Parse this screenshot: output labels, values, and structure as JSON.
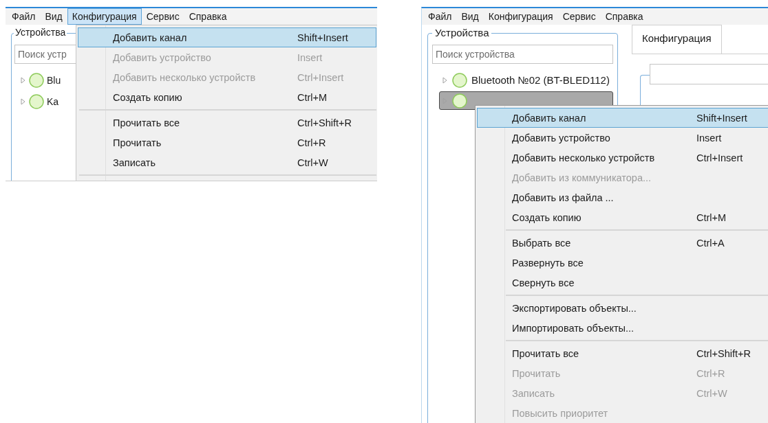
{
  "windows": [
    {
      "kind": "dropdown",
      "menu_bar": [
        {
          "label": "Файл",
          "selected": false
        },
        {
          "label": "Вид",
          "selected": false
        },
        {
          "label": "Конфигурация",
          "selected": true
        },
        {
          "label": "Сервис",
          "selected": false
        },
        {
          "label": "Справка",
          "selected": false
        }
      ],
      "devices": {
        "title": "Устройства",
        "search": {
          "placeholder": "Поиск устр"
        },
        "tree": [
          {
            "label": "Blu",
            "selected": false
          },
          {
            "label": "Ka",
            "selected": false
          }
        ]
      },
      "menu": {
        "items": [
          {
            "kind": "item",
            "label": "Добавить канал",
            "shortcut": "Shift+Insert",
            "selected": true,
            "disabled": false
          },
          {
            "kind": "item",
            "label": "Добавить устройство",
            "shortcut": "Insert",
            "selected": false,
            "disabled": true
          },
          {
            "kind": "item",
            "label": "Добавить несколько устройств",
            "shortcut": "Ctrl+Insert",
            "selected": false,
            "disabled": true
          },
          {
            "kind": "item",
            "label": "Создать копию",
            "shortcut": "Ctrl+M",
            "selected": false,
            "disabled": false
          },
          {
            "kind": "separator"
          },
          {
            "kind": "item",
            "label": "Прочитать все",
            "shortcut": "Ctrl+Shift+R",
            "selected": false,
            "disabled": false
          },
          {
            "kind": "item",
            "label": "Прочитать",
            "shortcut": "Ctrl+R",
            "selected": false,
            "disabled": false
          },
          {
            "kind": "item",
            "label": "Записать",
            "shortcut": "Ctrl+W",
            "selected": false,
            "disabled": false
          },
          {
            "kind": "separator"
          }
        ]
      }
    },
    {
      "kind": "context",
      "menu_bar": [
        {
          "label": "Файл",
          "selected": false
        },
        {
          "label": "Вид",
          "selected": false
        },
        {
          "label": "Конфигурация",
          "selected": false
        },
        {
          "label": "Сервис",
          "selected": false
        },
        {
          "label": "Справка",
          "selected": false
        }
      ],
      "devices": {
        "title": "Устройства",
        "search": {
          "placeholder": "Поиск устройства"
        },
        "tree": [
          {
            "label": "Bluetooth №02  (BT-BLED112)",
            "selected": false
          },
          {
            "selected": true
          }
        ]
      },
      "tabs": [
        {
          "label": "Конфигурация",
          "selected": true
        }
      ],
      "menu": {
        "items": [
          {
            "kind": "item",
            "label": "Добавить канал",
            "shortcut": "Shift+Insert",
            "selected": true,
            "disabled": false
          },
          {
            "kind": "item",
            "label": "Добавить устройство",
            "shortcut": "Insert",
            "selected": false,
            "disabled": false
          },
          {
            "kind": "item",
            "label": "Добавить несколько устройств",
            "shortcut": "Ctrl+Insert",
            "selected": false,
            "disabled": false
          },
          {
            "kind": "item",
            "label": "Добавить из коммуникатора...",
            "selected": false,
            "disabled": true
          },
          {
            "kind": "item",
            "label": "Добавить из файла ...",
            "selected": false,
            "disabled": false
          },
          {
            "kind": "item",
            "label": "Создать копию",
            "shortcut": "Ctrl+M",
            "selected": false,
            "disabled": false
          },
          {
            "kind": "separator"
          },
          {
            "kind": "item",
            "label": "Выбрать все",
            "shortcut": "Ctrl+A",
            "selected": false,
            "disabled": false
          },
          {
            "kind": "item",
            "label": "Развернуть все",
            "selected": false,
            "disabled": false
          },
          {
            "kind": "item",
            "label": "Свернуть все",
            "selected": false,
            "disabled": false
          },
          {
            "kind": "separator"
          },
          {
            "kind": "item",
            "label": "Экспортировать объекты...",
            "selected": false,
            "disabled": false
          },
          {
            "kind": "item",
            "label": "Импортировать объекты...",
            "selected": false,
            "disabled": false
          },
          {
            "kind": "separator"
          },
          {
            "kind": "item",
            "label": "Прочитать все",
            "shortcut": "Ctrl+Shift+R",
            "selected": false,
            "disabled": false
          },
          {
            "kind": "item",
            "label": "Прочитать",
            "shortcut": "Ctrl+R",
            "selected": false,
            "disabled": true
          },
          {
            "kind": "item",
            "label": "Записать",
            "shortcut": "Ctrl+W",
            "selected": false,
            "disabled": true
          },
          {
            "kind": "item",
            "label": "Повысить приоритет",
            "selected": false,
            "disabled": true
          }
        ]
      }
    }
  ]
}
